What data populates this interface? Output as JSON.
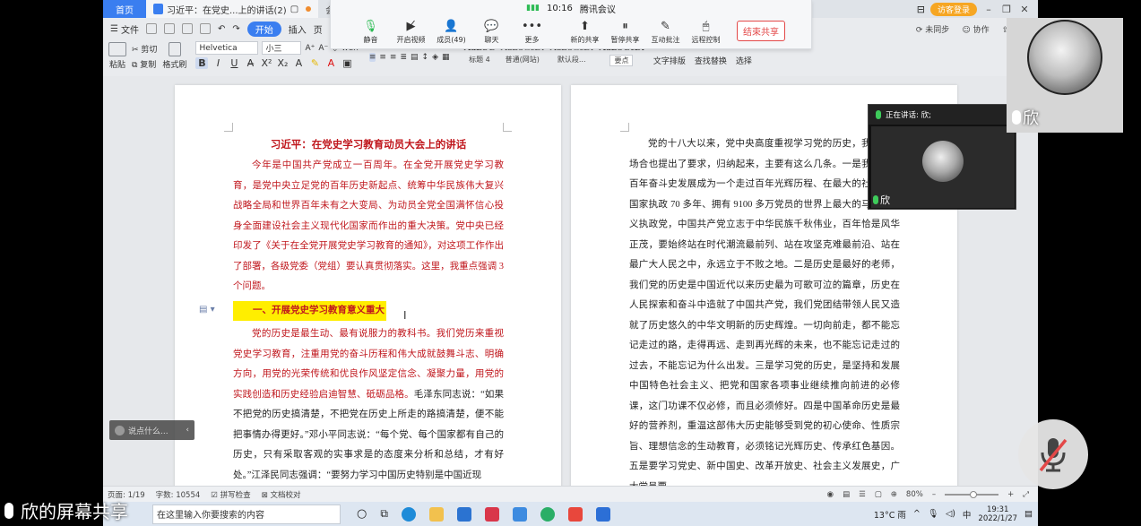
{
  "tabs": {
    "home": "首页",
    "doc_title": "习近平：在党史...上的讲话(2)",
    "extra": "会议"
  },
  "titlebar": {
    "visitor_login": "访客登录"
  },
  "menu": {
    "file": "文件",
    "start": "开始",
    "insert": "插入",
    "page": "页",
    "sync": "未同步",
    "collab": "协作",
    "share": "分享"
  },
  "ribbon": {
    "paste": "粘贴",
    "cut": "剪切",
    "copy": "复制",
    "format_painter": "格式刷",
    "font_name": "Helvetica",
    "font_size": "小三",
    "styles": [
      {
        "sample": "AaBbC",
        "label": "标题 4"
      },
      {
        "sample": "AaBbCcDı",
        "label": "普通(网站)"
      },
      {
        "sample": "AaBbCcDı",
        "label": "默认段..."
      },
      {
        "sample": "AaBbCcDı",
        "label": "要点"
      }
    ],
    "text_layout": "文字排版",
    "find_replace": "查找替换",
    "select": "选择"
  },
  "meeting": {
    "time": "10:16",
    "app_name": "腾讯会议",
    "tools": [
      {
        "icon": "mic-icon",
        "label": "静音"
      },
      {
        "icon": "video-off-icon",
        "label": "开启视频"
      },
      {
        "icon": "members-icon",
        "label": "成员(49)"
      },
      {
        "icon": "chat-icon",
        "label": "聊天"
      },
      {
        "icon": "more-icon",
        "label": "更多"
      },
      {
        "icon": "new-share-icon",
        "label": "新的共享"
      },
      {
        "icon": "pause-share-icon",
        "label": "暂停共享"
      },
      {
        "icon": "annotate-icon",
        "label": "互动批注"
      },
      {
        "icon": "remote-control-icon",
        "label": "远程控制"
      }
    ],
    "end_share": "结束共享"
  },
  "document": {
    "title": "习近平：在党史学习教育动员大会上的讲话",
    "para1": "今年是中国共产党成立一百周年。在全党开展党史学习教育，是党中央立足党的百年历史新起点、统筹中华民族伟大复兴战略全局和世界百年未有之大变局、为动员全党全国满怀信心投身全面建设社会主义现代化国家而作出的重大决策。党中央已经印发了《关于在全党开展党史学习教育的通知》，对这项工作作出了部署，各级党委（党组）要认真贯彻落实。这里，我重点强调 3 个问题。",
    "heading1": "一、开展党史学习教育意义重大",
    "para2_red": "党的历史是最生动、最有说服力的教科书。我们党历来重视党史学习教育，注重用党的奋斗历程和伟大成就鼓舞斗志、明确方向，用党的光荣传统和优良作风坚定信念、凝聚力量，用党的实践创造和历史经验启迪智慧、砥砺品格。",
    "para2_black": "毛泽东同志说：“如果不把党的历史搞清楚，不把党在历史上所走的路搞清楚，便不能把事情办得更好。”邓小平同志说：“每个党、每个国家都有自己的历史，只有采取客观的实事求是的态度来分析和总结，才有好处。”江泽民同志强调：“要努力学习中国历史特别是中国近现",
    "right_page": "党的十八大以来，党中央高度重视学习党的历史，我在很多场合也提出了要求，归纳起来，主要有这么几条。一是我们党的百年奋斗史发展成为一个走过百年光辉历程、在最大的社会主义国家执政 70 多年、拥有 9100 多万党员的世界上最大的马克思主义执政党，中国共产党立志于中华民族千秋伟业，百年恰是风华正茂，要始终站在时代潮流最前列、站在攻坚克难最前沿、站在最广大人民之中，永远立于不败之地。二是历史是最好的老师，我们党的历史是中国近代以来历史最为可歌可泣的篇章，历史在人民探索和奋斗中造就了中国共产党，我们党团结带领人民又造就了历史悠久的中华文明新的历史辉煌。一切向前走，都不能忘记走过的路，走得再远、走到再光辉的未来，也不能忘记走过的过去，不能忘记为什么出发。三是学习党的历史，是坚持和发展中国特色社会主义、把党和国家各项事业继续推向前进的必修课，这门功课不仅必修，而且必须修好。四是中国革命历史是最好的营养剂，重温这部伟大历史能够受到党的初心使命、性质宗旨、理想信念的生动教育，必须铭记光辉历史、传承红色基因。五是要学习党史、新中国史、改革开放史、社会主义发展史，广大党员要"
  },
  "speak_tip": "说点什么...",
  "statusbar": {
    "page": "页面: 1/19",
    "words": "字数: 10554",
    "spell": "拼写检查",
    "proof": "文档校对",
    "zoom": "80%"
  },
  "taskbar": {
    "search_placeholder": "在这里输入你要搜索的内容",
    "weather": "13°C 雨",
    "ime": "中",
    "time": "19:31",
    "date": "2022/1/27"
  },
  "video": {
    "speaking_label": "正在讲话: 欣;",
    "participant_name": "欣"
  },
  "share_label": "欣的屏幕共享",
  "colors": {
    "accent": "#3a7ef0",
    "doc_red": "#c0171d",
    "highlight": "#ffee00",
    "end_share": "#e34848"
  }
}
